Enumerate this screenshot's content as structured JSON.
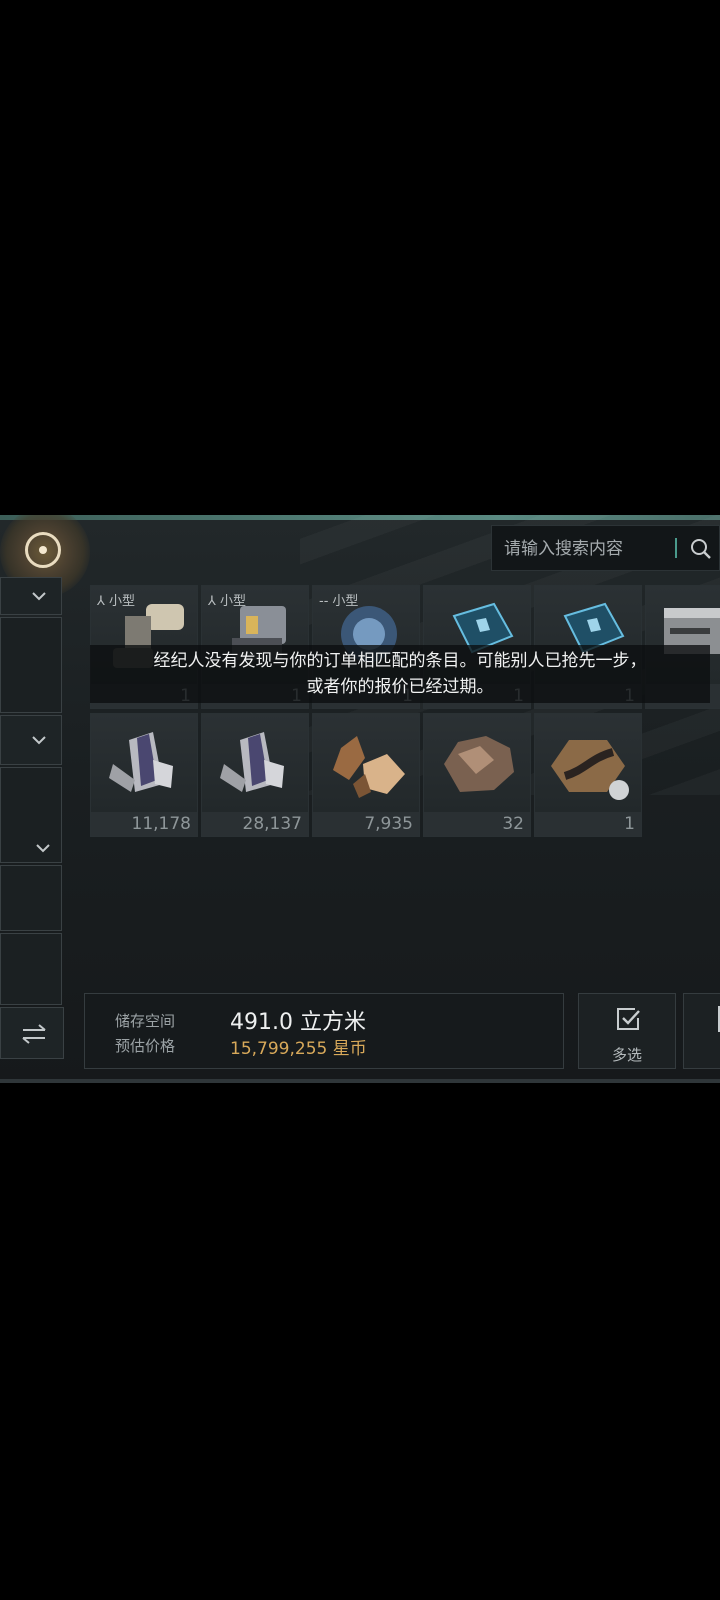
{
  "search": {
    "placeholder": "请输入搜索内容"
  },
  "tooltip": {
    "line1": "经纪人没有发现与你的订单相匹配的条目。可能别人已抢先一步，",
    "line2": "或者你的报价已经过期。"
  },
  "row1": [
    {
      "size_label": "小型",
      "qty": "1"
    },
    {
      "size_label": "小型",
      "qty": "1"
    },
    {
      "size_label": "小型",
      "qty": "1"
    },
    {
      "size_label": "",
      "qty": "1"
    },
    {
      "size_label": "",
      "qty": "1"
    },
    {
      "size_label": "",
      "qty": ""
    }
  ],
  "row2": [
    {
      "qty": "11,178"
    },
    {
      "qty": "28,137"
    },
    {
      "qty": "7,935"
    },
    {
      "qty": "32"
    },
    {
      "qty": "1"
    }
  ],
  "storage": {
    "space_label": "储存空间",
    "space_value": "491.0 立方米",
    "price_label": "预估价格",
    "price_value": "15,799,255 星币"
  },
  "buttons": {
    "multi_select": "多选"
  },
  "colors": {
    "accent": "#4e7a72",
    "price": "#d8a95a"
  }
}
